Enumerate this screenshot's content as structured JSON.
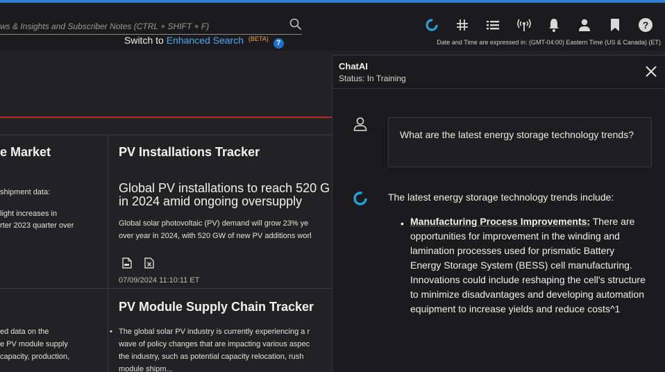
{
  "search": {
    "placeholder": "ws & Insights and Subscriber Notes (CTRL + SHIFT + F)",
    "switch_prefix": "Switch to",
    "enhanced_link": "Enhanced Search",
    "beta": "(BETA)",
    "help": "?"
  },
  "toolbar": {
    "icons": [
      "chatai-icon",
      "grid-tools-icon",
      "list-icon",
      "broadcast-icon",
      "bell-icon",
      "user-icon",
      "bookmark-icon",
      "help-icon"
    ],
    "accent": "#1ea5e0"
  },
  "timezone_note": "Date and Time are expressed in: (GMT-04:00) Eastern Time (US & Canada) (ET)",
  "cards": {
    "left_top": {
      "title": "e Market",
      "lines": [
        "shipment data:",
        "light increases in",
        "rter 2023 quarter over"
      ]
    },
    "tracker1": {
      "title": "PV Installations Tracker",
      "headline_line1": "Global PV installations to reach 520 G",
      "headline_line2": "in 2024 amid ongoing oversupply",
      "summary_line1": "Global solar photovoltaic (PV) demand will grow 23% ye",
      "summary_line2": "over year in 2024, with 520 GW of new PV additions worl",
      "date": "07/09/2024 11:10:11 ET"
    },
    "left_bottom": {
      "lines": [
        "ed data on the",
        "e PV module supply",
        "capacity, production,"
      ]
    },
    "tracker2": {
      "title": "PV Module Supply Chain Tracker",
      "bullet": "•",
      "lines": [
        "The global solar PV industry is currently experiencing a r",
        "wave of policy changes that are impacting various aspec",
        "the industry, such as potential capacity relocation, rush",
        "module shipm..."
      ]
    }
  },
  "colors": {
    "red_rule": "#c42a24",
    "link_blue": "#4aa8f0",
    "beta_orange": "#f0a93a"
  },
  "chat": {
    "title": "ChatAI",
    "status": "Status: In Training",
    "question": "What are the latest energy storage technology trends?",
    "answer_intro": "The latest energy storage technology trends include:",
    "answer_bullet": "•",
    "answer_bold": "Manufacturing Process Improvements:",
    "answer_text": " There are opportunities for improvement in the winding and lamination processes used for prismatic Battery Energy Storage System (BESS) cell manufacturing. Innovations could include reshaping the cell's structure to minimize disadvantages and developing automation equipment to increase yields and reduce costs^1"
  }
}
